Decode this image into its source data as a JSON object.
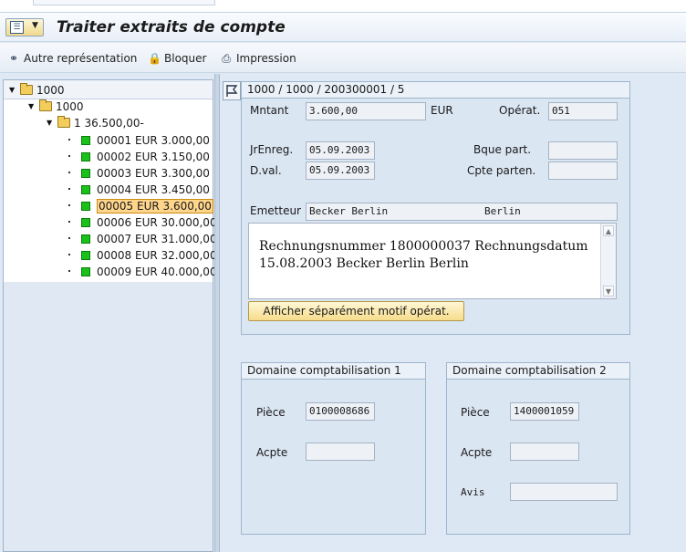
{
  "title": "Traiter extraits de compte",
  "toolbar": {
    "autre_representation": "Autre représentation",
    "bloquer": "Bloquer",
    "impression": "Impression"
  },
  "tree": {
    "root": "1000",
    "child": "1000",
    "grandchild": "1  36.500,00-",
    "items": [
      {
        "id": "00001",
        "amount": "EUR 3.000,00"
      },
      {
        "id": "00002",
        "amount": "EUR 3.150,00"
      },
      {
        "id": "00003",
        "amount": "EUR 3.300,00"
      },
      {
        "id": "00004",
        "amount": "EUR 3.450,00"
      },
      {
        "id": "00005",
        "amount": "EUR 3.600,00"
      },
      {
        "id": "00006",
        "amount": "EUR 30.000,00"
      },
      {
        "id": "00007",
        "amount": "EUR 31.000,00"
      },
      {
        "id": "00008",
        "amount": "EUR 32.000,00"
      },
      {
        "id": "00009",
        "amount": "EUR 40.000,00"
      }
    ],
    "selected_index": 4
  },
  "detail": {
    "header": "1000 / 1000 / 200300001 / 5",
    "mntant_label": "Mntant",
    "mntant_value": "3.600,00",
    "currency": "EUR",
    "operat_label": "Opérat.",
    "operat_value": "051",
    "jrenreg_label": "JrEnreg.",
    "jrenreg_value": "05.09.2003",
    "dval_label": "D.val.",
    "dval_value": "05.09.2003",
    "bque_label": "Bque part.",
    "bque_value": "",
    "cpte_label": "Cpte parten.",
    "cpte_value": "",
    "emetteur_label": "Emetteur",
    "emetteur_value": "Becker Berlin                Berlin",
    "text_line1": "Rechnungsnummer 1800000037 Rechnungsdatum",
    "text_line2": "15.08.2003 Becker Berlin Berlin",
    "motif_button": "Afficher séparément motif opérat."
  },
  "domaine1": {
    "title": "Domaine comptabilisation 1",
    "piece_label": "Pièce",
    "piece_value": "0100008686",
    "acpte_label": "Acpte",
    "acpte_value": ""
  },
  "domaine2": {
    "title": "Domaine comptabilisation 2",
    "piece_label": "Pièce",
    "piece_value": "1400001059",
    "acpte_label": "Acpte",
    "acpte_value": "",
    "avis_label": "Avis",
    "avis_value": ""
  }
}
